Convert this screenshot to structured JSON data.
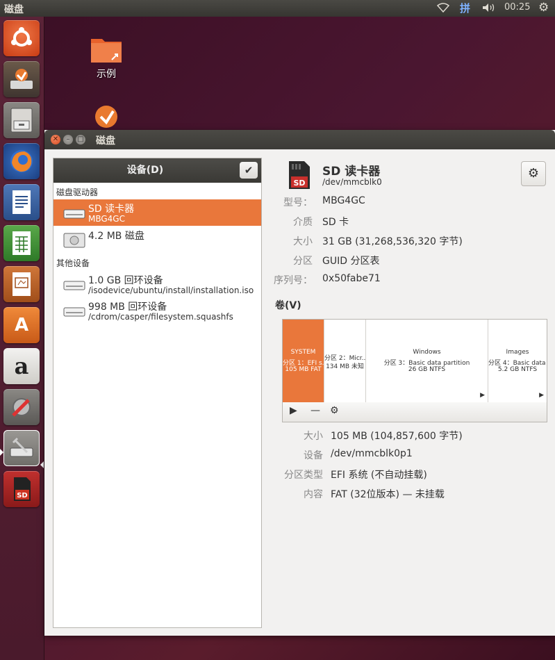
{
  "panel": {
    "app_title": "磁盘",
    "input_method": "拼",
    "clock": "00:25"
  },
  "desktop": {
    "icons": [
      {
        "label": "示例"
      }
    ]
  },
  "window": {
    "title": "磁盘"
  },
  "devices": {
    "header_label": "设备(D)",
    "section_drives": "磁盘驱动器",
    "section_other": "其他设备",
    "drives": [
      {
        "name": "SD 读卡器",
        "sub": "MBG4GC",
        "selected": true
      },
      {
        "name": "4.2 MB 磁盘",
        "sub": "",
        "selected": false
      }
    ],
    "other": [
      {
        "name": "1.0 GB 回环设备",
        "sub": "/isodevice/ubuntu/install/installation.iso"
      },
      {
        "name": "998 MB 回环设备",
        "sub": "/cdrom/casper/filesystem.squashfs"
      }
    ]
  },
  "detail": {
    "icon_text": "SD",
    "title": "SD 读卡器",
    "path": "/dev/mmcblk0",
    "props": [
      {
        "label": "型号：",
        "value": "MBG4GC"
      },
      {
        "label": "介质",
        "value": "SD 卡"
      },
      {
        "label": "大小",
        "value": "31 GB (31,268,536,320 字节)"
      },
      {
        "label": "分区",
        "value": "GUID 分区表"
      },
      {
        "label": "序列号：",
        "value": "0x50fabe71"
      }
    ],
    "volumes_label": "卷(V)",
    "partitions": [
      {
        "l1": "SYSTEM",
        "l2": "分区 1：EFI s...",
        "l3": "105 MB FAT",
        "selected": true
      },
      {
        "l1": "",
        "l2": "分区 2：Micr...",
        "l3": "134 MB 未知",
        "selected": false
      },
      {
        "l1": "Windows",
        "l2": "分区 3：Basic data partition",
        "l3": "26 GB NTFS",
        "selected": false
      },
      {
        "l1": "Images",
        "l2": "分区 4：Basic data ...",
        "l3": "5.2 GB NTFS",
        "selected": false
      }
    ],
    "vol_props": [
      {
        "label": "大小",
        "value": "105 MB (104,857,600 字节)"
      },
      {
        "label": "设备",
        "value": "/dev/mmcblk0p1"
      },
      {
        "label": "分区类型",
        "value": "EFI 系统 (不自动挂载)"
      },
      {
        "label": "内容",
        "value": "FAT (32位版本) — 未挂载"
      }
    ]
  },
  "colors": {
    "accent": "#e9773b",
    "panel": "#3c3b37"
  }
}
